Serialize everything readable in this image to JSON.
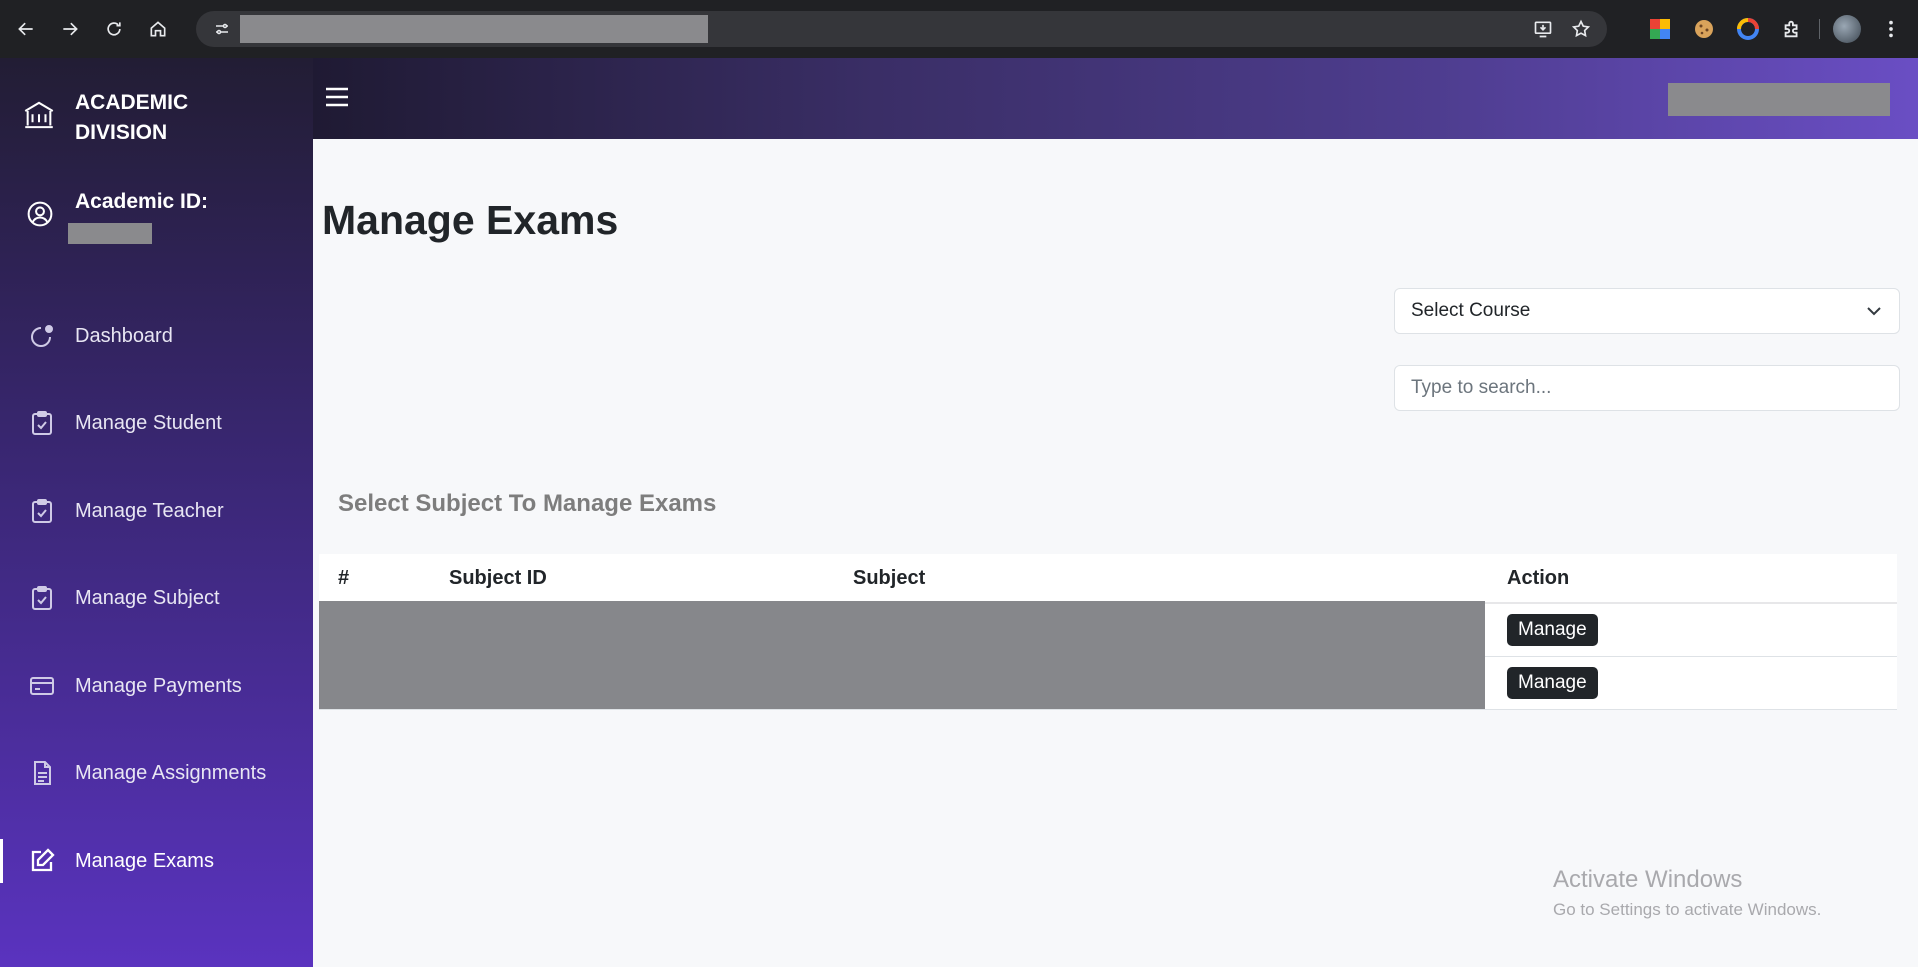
{
  "sidebar": {
    "brand_title": "ACADEMIC DIVISION",
    "academic_id_label": "Academic ID:",
    "items": [
      {
        "label": "Dashboard",
        "icon": "dashboard-icon"
      },
      {
        "label": "Manage Student",
        "icon": "clipboard-check-icon"
      },
      {
        "label": "Manage Teacher",
        "icon": "clipboard-check-icon"
      },
      {
        "label": "Manage Subject",
        "icon": "clipboard-check-icon"
      },
      {
        "label": "Manage Payments",
        "icon": "credit-card-icon"
      },
      {
        "label": "Manage Assignments",
        "icon": "document-icon"
      },
      {
        "label": "Manage Exams",
        "icon": "pencil-square-icon",
        "active": true
      }
    ]
  },
  "main": {
    "title": "Manage Exams",
    "course_select": {
      "value": "Select Course"
    },
    "search": {
      "placeholder": "Type to search..."
    },
    "section_title": "Select Subject To Manage Exams",
    "table": {
      "headers": [
        "#",
        "Subject ID",
        "Subject",
        "Action"
      ],
      "rows": [
        {
          "action": "Manage"
        },
        {
          "action": "Manage"
        }
      ]
    }
  },
  "watermark": {
    "line1": "Activate Windows",
    "line2": "Go to Settings to activate Windows."
  },
  "colors": {
    "sidebar_top": "#221d34",
    "sidebar_bottom": "#5a33bf",
    "button_dark": "#212529"
  }
}
